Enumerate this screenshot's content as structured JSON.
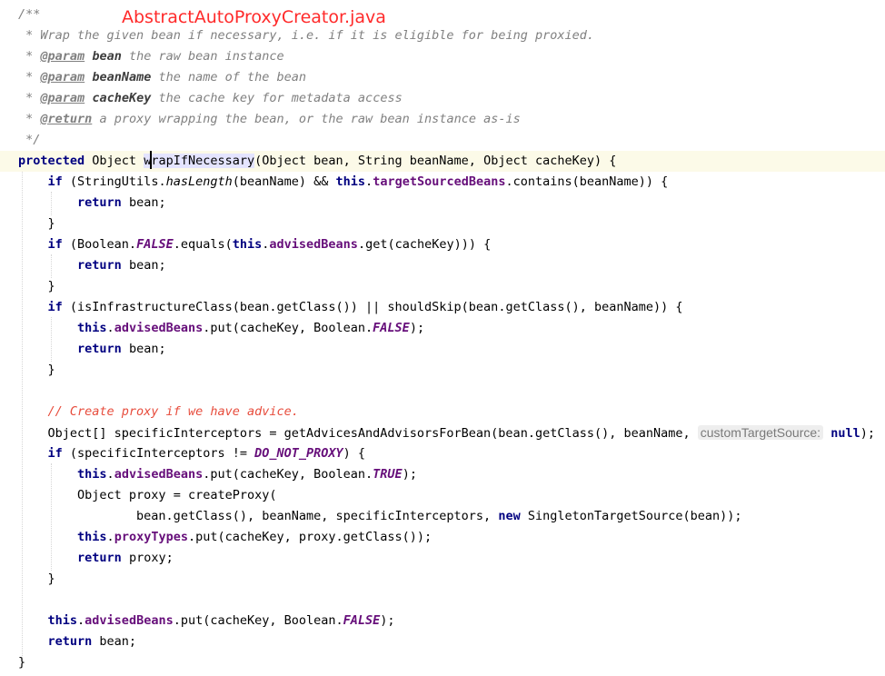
{
  "file_title": "AbstractAutoProxyCreator.java",
  "lines": [
    {
      "indent": "",
      "tokens": [
        {
          "t": "/**",
          "c": "comment"
        }
      ]
    },
    {
      "indent": " ",
      "tokens": [
        {
          "t": "* Wrap the given bean if necessary, i.e. if it is eligible for being proxied.",
          "c": "comment"
        }
      ]
    },
    {
      "indent": " ",
      "tokens": [
        {
          "t": "* ",
          "c": "comment"
        },
        {
          "t": "@param",
          "c": "doctag"
        },
        {
          "t": " ",
          "c": "comment"
        },
        {
          "t": "bean",
          "c": "docparam"
        },
        {
          "t": " the raw bean instance",
          "c": "comment"
        }
      ]
    },
    {
      "indent": " ",
      "tokens": [
        {
          "t": "* ",
          "c": "comment"
        },
        {
          "t": "@param",
          "c": "doctag"
        },
        {
          "t": " ",
          "c": "comment"
        },
        {
          "t": "beanName",
          "c": "docparam"
        },
        {
          "t": " the name of the bean",
          "c": "comment"
        }
      ]
    },
    {
      "indent": " ",
      "tokens": [
        {
          "t": "* ",
          "c": "comment"
        },
        {
          "t": "@param",
          "c": "doctag"
        },
        {
          "t": " ",
          "c": "comment"
        },
        {
          "t": "cacheKey",
          "c": "docparam"
        },
        {
          "t": " the cache key for metadata access",
          "c": "comment"
        }
      ]
    },
    {
      "indent": " ",
      "tokens": [
        {
          "t": "* ",
          "c": "comment"
        },
        {
          "t": "@return",
          "c": "doctag"
        },
        {
          "t": " a proxy wrapping the bean, or the raw bean instance as-is",
          "c": "comment"
        }
      ]
    },
    {
      "indent": " ",
      "tokens": [
        {
          "t": "*/",
          "c": "comment"
        }
      ]
    },
    {
      "indent": "",
      "current": true,
      "tokens": [
        {
          "t": "protected",
          "c": "kw"
        },
        {
          "t": " Object "
        },
        {
          "t": "wrapIfNecessary",
          "c": "method-decl"
        },
        {
          "t": "(Object bean, String beanName, Object cacheKey) {"
        }
      ]
    },
    {
      "indent": "    ",
      "tokens": [
        {
          "t": "if",
          "c": "kw"
        },
        {
          "t": " (StringUtils."
        },
        {
          "t": "hasLength",
          "c": "italic"
        },
        {
          "t": "(beanName) && "
        },
        {
          "t": "this",
          "c": "kw"
        },
        {
          "t": "."
        },
        {
          "t": "targetSourcedBeans",
          "c": "field"
        },
        {
          "t": ".contains(beanName)) {"
        }
      ]
    },
    {
      "indent": "        ",
      "tokens": [
        {
          "t": "return",
          "c": "kw"
        },
        {
          "t": " bean;"
        }
      ]
    },
    {
      "indent": "    ",
      "tokens": [
        {
          "t": "}"
        }
      ]
    },
    {
      "indent": "    ",
      "tokens": [
        {
          "t": "if",
          "c": "kw"
        },
        {
          "t": " (Boolean."
        },
        {
          "t": "FALSE",
          "c": "static"
        },
        {
          "t": ".equals("
        },
        {
          "t": "this",
          "c": "kw"
        },
        {
          "t": "."
        },
        {
          "t": "advisedBeans",
          "c": "field"
        },
        {
          "t": ".get(cacheKey))) {"
        }
      ]
    },
    {
      "indent": "        ",
      "tokens": [
        {
          "t": "return",
          "c": "kw"
        },
        {
          "t": " bean;"
        }
      ]
    },
    {
      "indent": "    ",
      "tokens": [
        {
          "t": "}"
        }
      ]
    },
    {
      "indent": "    ",
      "tokens": [
        {
          "t": "if",
          "c": "kw"
        },
        {
          "t": " (isInfrastructureClass(bean.getClass()) || shouldSkip(bean.getClass(), beanName)) {"
        }
      ]
    },
    {
      "indent": "        ",
      "tokens": [
        {
          "t": "this",
          "c": "kw"
        },
        {
          "t": "."
        },
        {
          "t": "advisedBeans",
          "c": "field"
        },
        {
          "t": ".put(cacheKey, Boolean."
        },
        {
          "t": "FALSE",
          "c": "static"
        },
        {
          "t": ");"
        }
      ]
    },
    {
      "indent": "        ",
      "tokens": [
        {
          "t": "return",
          "c": "kw"
        },
        {
          "t": " bean;"
        }
      ]
    },
    {
      "indent": "    ",
      "tokens": [
        {
          "t": "}"
        }
      ]
    },
    {
      "indent": "",
      "tokens": []
    },
    {
      "indent": "    ",
      "tokens": [
        {
          "t": "// Create proxy if we have advice.",
          "c": "line-comment"
        }
      ]
    },
    {
      "indent": "    ",
      "tokens": [
        {
          "t": "Object[] specificInterceptors = getAdvicesAndAdvisorsForBean(bean.getClass(), beanName, "
        },
        {
          "t": "customTargetSource:",
          "c": "hint"
        },
        {
          "t": " "
        },
        {
          "t": "null",
          "c": "kw"
        },
        {
          "t": ");"
        }
      ]
    },
    {
      "indent": "    ",
      "tokens": [
        {
          "t": "if",
          "c": "kw"
        },
        {
          "t": " (specificInterceptors != "
        },
        {
          "t": "DO_NOT_PROXY",
          "c": "static"
        },
        {
          "t": ") {"
        }
      ]
    },
    {
      "indent": "        ",
      "tokens": [
        {
          "t": "this",
          "c": "kw"
        },
        {
          "t": "."
        },
        {
          "t": "advisedBeans",
          "c": "field"
        },
        {
          "t": ".put(cacheKey, Boolean."
        },
        {
          "t": "TRUE",
          "c": "static"
        },
        {
          "t": ");"
        }
      ]
    },
    {
      "indent": "        ",
      "tokens": [
        {
          "t": "Object proxy = createProxy("
        }
      ]
    },
    {
      "indent": "                ",
      "tokens": [
        {
          "t": "bean.getClass(), beanName, specificInterceptors, "
        },
        {
          "t": "new",
          "c": "kw"
        },
        {
          "t": " SingletonTargetSource(bean));"
        }
      ]
    },
    {
      "indent": "        ",
      "tokens": [
        {
          "t": "this",
          "c": "kw"
        },
        {
          "t": "."
        },
        {
          "t": "proxyTypes",
          "c": "field"
        },
        {
          "t": ".put(cacheKey, proxy.getClass());"
        }
      ]
    },
    {
      "indent": "        ",
      "tokens": [
        {
          "t": "return",
          "c": "kw"
        },
        {
          "t": " proxy;"
        }
      ]
    },
    {
      "indent": "    ",
      "tokens": [
        {
          "t": "}"
        }
      ]
    },
    {
      "indent": "",
      "tokens": []
    },
    {
      "indent": "    ",
      "tokens": [
        {
          "t": "this",
          "c": "kw"
        },
        {
          "t": "."
        },
        {
          "t": "advisedBeans",
          "c": "field"
        },
        {
          "t": ".put(cacheKey, Boolean."
        },
        {
          "t": "FALSE",
          "c": "static"
        },
        {
          "t": ");"
        }
      ]
    },
    {
      "indent": "    ",
      "tokens": [
        {
          "t": "return",
          "c": "kw"
        },
        {
          "t": " bean;"
        }
      ]
    },
    {
      "indent": "",
      "tokens": [
        {
          "t": "}"
        }
      ]
    }
  ]
}
